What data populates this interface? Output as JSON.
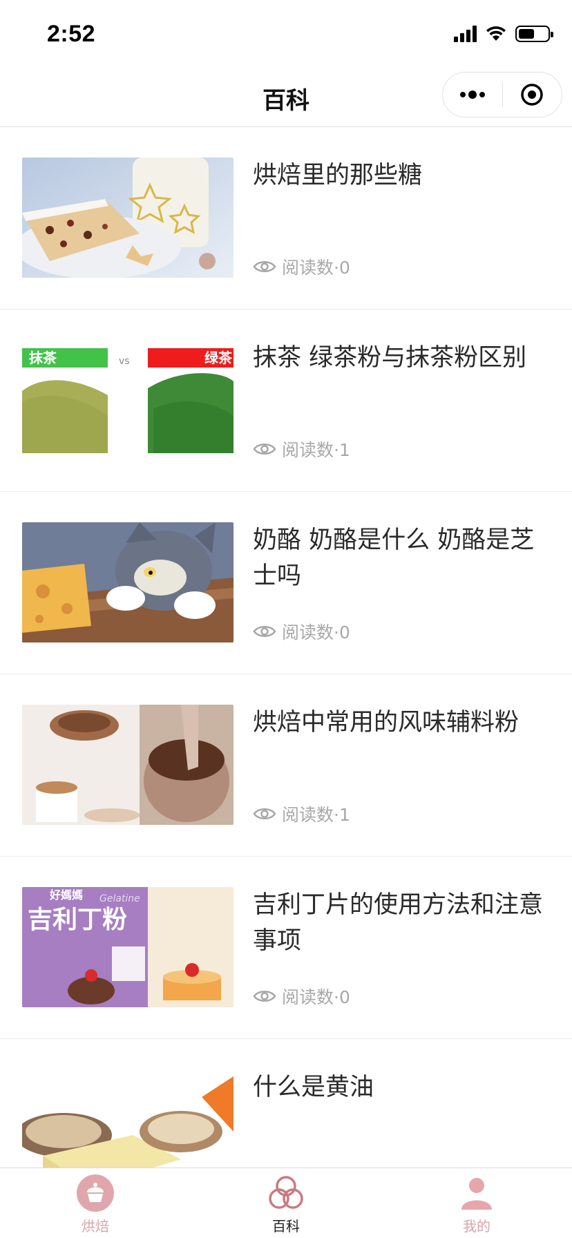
{
  "status_bar": {
    "time": "2:52"
  },
  "nav": {
    "title": "百科"
  },
  "articles": [
    {
      "title": "烘焙里的那些糖",
      "meta": "阅读数·0",
      "image": "stollen-cake-photo"
    },
    {
      "title": "抹茶 绿茶粉与抹茶粉区别",
      "meta": "阅读数·1",
      "image": "matcha-vs-green-tea-photo",
      "image_text": {
        "left": "抹茶",
        "vs": "vs",
        "right": "绿茶"
      }
    },
    {
      "title": "奶酪 奶酪是什么 奶酪是芝士吗",
      "meta": "阅读数·0",
      "image": "cartoon-cat-cheese-image"
    },
    {
      "title": "烘焙中常用的风味辅料粉",
      "meta": "阅读数·1",
      "image": "cocoa-powder-photo"
    },
    {
      "title": "吉利丁片的使用方法和注意事项",
      "meta": "阅读数·0",
      "image": "gelatin-powder-package-photo",
      "image_text": {
        "brand": "好媽媽",
        "product": "吉利丁粉",
        "en": "Gelatine"
      }
    },
    {
      "title": "什么是黄油",
      "meta": "",
      "image": "butter-bread-photo"
    }
  ],
  "tabs": [
    {
      "label": "烘焙",
      "icon": "cupcake-icon",
      "active": false
    },
    {
      "label": "百科",
      "icon": "circles-icon",
      "active": true
    },
    {
      "label": "我的",
      "icon": "person-icon",
      "active": false
    }
  ],
  "colors": {
    "tab_inactive": "#d9a3a8",
    "tab_icon": "#e6a6ac",
    "meta_text": "#a8a8a8",
    "tab_active_text": "#222222"
  }
}
